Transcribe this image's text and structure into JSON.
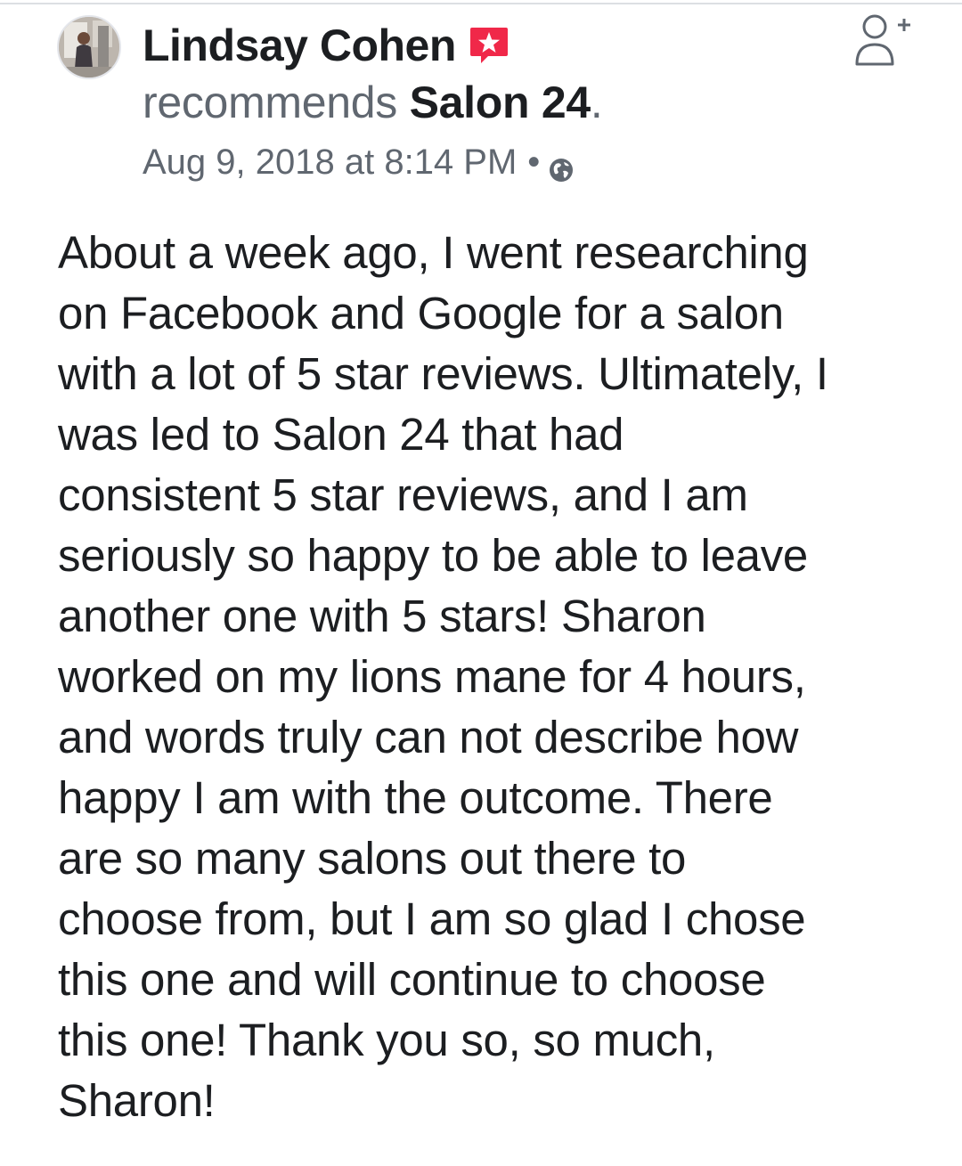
{
  "post": {
    "author": "Lindsay Cohen",
    "recommend_verb": "recommends",
    "page_name": "Salon 24",
    "page_suffix": ".",
    "timestamp": "Aug 9, 2018 at 8:14 PM",
    "separator": "•",
    "privacy_icon": "globe-icon",
    "recommendation_icon": "recommendation-star-icon",
    "follow_icon": "add-friend-icon",
    "accent_color": "#f02849",
    "review": "About a week ago, I went researching\non Facebook and Google for a salon\nwith a lot of 5 star reviews. Ultimately, I\nwas led to Salon 24 that had\nconsistent 5 star reviews, and I am\nseriously so happy to be able to leave\nanother one with 5 stars! Sharon\nworked on my lions mane for 4 hours,\nand words truly can not describe how\nhappy I am with the outcome. There\nare so many salons out there to\nchoose from, but I am so glad I chose\nthis one and will continue to choose\nthis one! Thank you so, so much,\nSharon!"
  }
}
